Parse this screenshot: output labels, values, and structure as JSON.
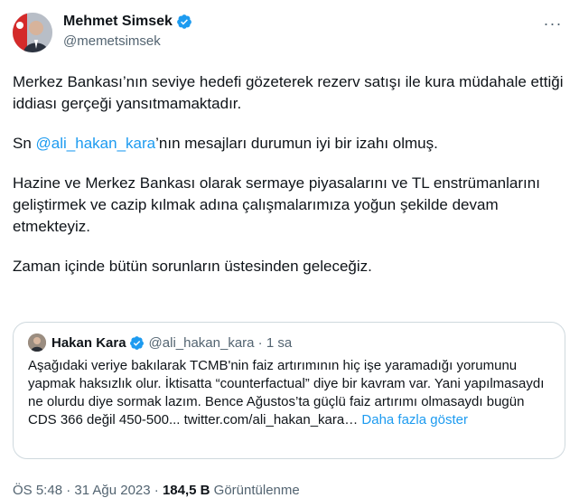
{
  "author": {
    "name": "Mehmet Simsek",
    "handle": "@memetsimsek"
  },
  "more_icon": "more-horizontal-icon",
  "tweet": {
    "p1": "Merkez Bankası’nın seviye hedefi gözeterek rezerv satışı ile kura müdahale ettiği iddiası gerçeği yansıtmamaktadır.",
    "p2_prefix": "Sn ",
    "p2_mention": "@ali_hakan_kara",
    "p2_suffix": "’nın mesajları durumun iyi bir izahı olmuş.",
    "p3": "Hazine ve Merkez Bankası olarak sermaye piyasalarını ve TL enstrümanlarını geliştirmek ve cazip kılmak adına çalışmalarımıza yoğun şekilde devam etmekteyiz.",
    "p4": "Zaman içinde bütün sorunların üstesinden geleceğiz."
  },
  "quote": {
    "name": "Hakan Kara",
    "meta": "@ali_hakan_kara · 1 sa",
    "text": "Aşağıdaki veriye bakılarak TCMB'nin faiz artırımının hiç işe yaramadığı yorumunu yapmak haksızlık olur. İktisatta “counterfactual” diye bir kavram var. Yani yapılmasaydı ne olurdu diye sormak lazım. Bence Ağustos’ta güçlü faiz artırımı olmasaydı bugün CDS 366 değil 450-500...",
    "link": "twitter.com/ali_hakan_kara…",
    "more_label": "Daha fazla göster"
  },
  "footer": {
    "time": "ÖS 5:48 · 31 Ağu 2023 · ",
    "views": "184,5 B",
    "views_label": " Görüntülenme"
  },
  "colors": {
    "accent": "#1d9bf0",
    "muted": "#536471",
    "border": "#cfd9de"
  }
}
